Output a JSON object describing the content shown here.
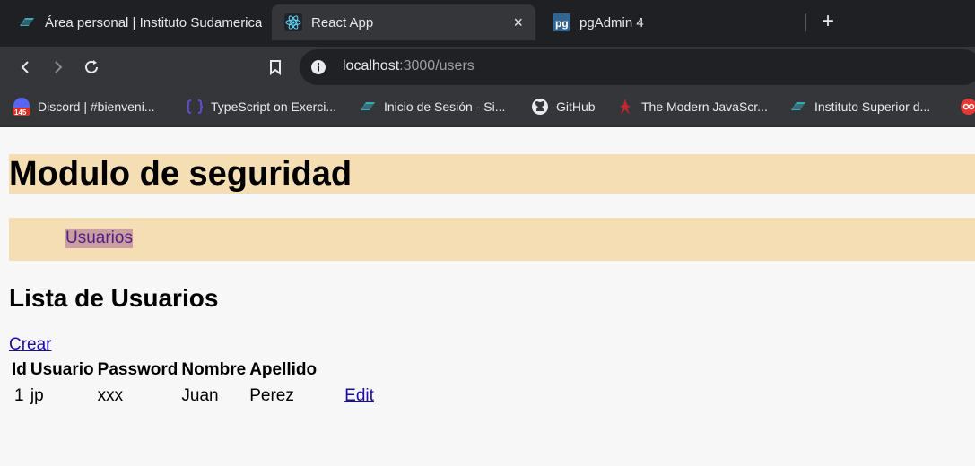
{
  "browser": {
    "tabs": [
      {
        "label": "Área personal | Instituto Sudamerica",
        "icon": "institute-icon",
        "active": false
      },
      {
        "label": "React App",
        "icon": "react-icon",
        "active": true,
        "close": "×"
      },
      {
        "label": "pgAdmin 4",
        "icon": "pgadmin-icon",
        "active": false
      }
    ],
    "new_tab": "+",
    "url_host": "localhost",
    "url_rest": ":3000/users",
    "bookmarks": [
      {
        "label": "Discord | #bienveni...",
        "icon": "discord-icon",
        "badge": "145"
      },
      {
        "label": "TypeScript on Exerci...",
        "icon": "exercism-icon"
      },
      {
        "label": "Inicio de Sesión - Si...",
        "icon": "institute-icon"
      },
      {
        "label": "GitHub",
        "icon": "github-icon"
      },
      {
        "label": "The Modern JavaScr...",
        "icon": "javascript-info-icon"
      },
      {
        "label": "Instituto Superior d...",
        "icon": "institute-icon"
      }
    ],
    "colors": {
      "tabbar": "#1f2024",
      "toolbar": "#35363a",
      "omnibox": "#202124"
    }
  },
  "page": {
    "title": "Modulo de seguridad",
    "nav": {
      "users_link": "Usuarios"
    },
    "list_title": "Lista de Usuarios",
    "create_link": "Crear",
    "table": {
      "headers": [
        "Id",
        "Usuario",
        "Password",
        "Nombre",
        "Apellido"
      ],
      "rows": [
        {
          "id": "1",
          "usuario": "jp",
          "password": "xxx",
          "nombre": "Juan",
          "apellido": "Perez",
          "action": "Edit"
        }
      ]
    },
    "colors": {
      "header_bg": "#f5deb3",
      "link_visited": "#551a8b",
      "link": "#1a0dab"
    }
  }
}
